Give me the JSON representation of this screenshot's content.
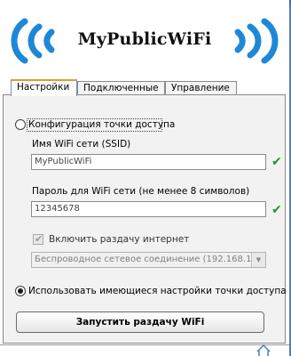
{
  "app": {
    "title": "MyPublicWiFi"
  },
  "tabs": [
    {
      "label": "Настройки",
      "active": true
    },
    {
      "label": "Подключенные",
      "active": false
    },
    {
      "label": "Управление",
      "active": false
    }
  ],
  "settings": {
    "hotspot_config_radio": {
      "label": "Конфигурация точки доступа",
      "checked": false
    },
    "ssid": {
      "label": "Имя WiFi сети (SSID)",
      "value": "MyPublicWiFi"
    },
    "password": {
      "label": "Пароль для WiFi сети (не менее 8 символов)",
      "value": "12345678"
    },
    "share_internet": {
      "label": "Включить раздачу интернет",
      "checked": true,
      "enabled": false
    },
    "connection_select": {
      "value": "Беспроводное сетевое соединение (192.168.1.1"
    },
    "use_existing_radio": {
      "label": "Использовать имеющиеся настройки точки доступа",
      "checked": true
    },
    "start_button": {
      "label": "Запустить раздачу WiFi"
    }
  },
  "colors": {
    "accent_blue": "#1e88d8",
    "tab_highlight": "#e39b2c",
    "valid_check": "#1f9a1f"
  },
  "icons": {
    "wave_left": "wifi-waves-left-icon",
    "wave_right": "wifi-waves-right-icon",
    "valid": "checkmark-icon",
    "home": "home-icon"
  }
}
